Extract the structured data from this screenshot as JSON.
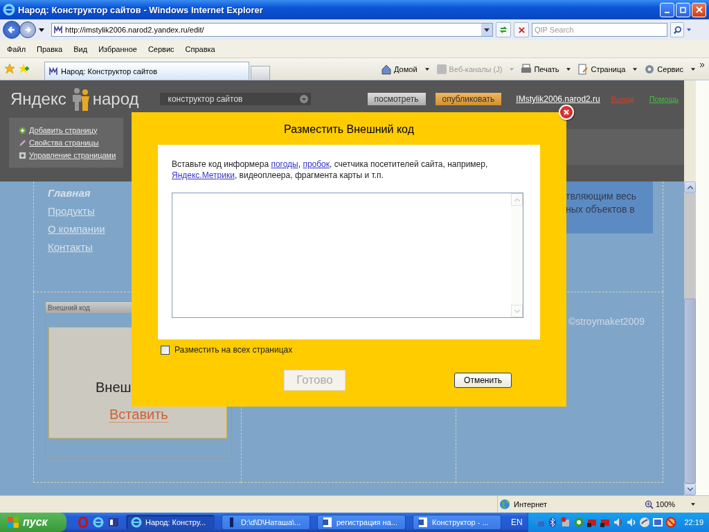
{
  "window": {
    "title": "Народ: Конструктор сайтов - Windows Internet Explorer"
  },
  "address_bar": {
    "url": "http://imstylik2006.narod2.yandex.ru/edit/"
  },
  "search": {
    "placeholder": "QIP Search"
  },
  "menu": [
    "Файл",
    "Правка",
    "Вид",
    "Избранное",
    "Сервис",
    "Справка"
  ],
  "browser_tab": {
    "title": "Народ: Конструктор сайтов"
  },
  "command_bar": [
    {
      "label": "Домой",
      "kind": "home",
      "disabled": false
    },
    {
      "label": "Веб-каналы (J)",
      "kind": "feeds",
      "disabled": true
    },
    {
      "label": "Печать",
      "kind": "print",
      "disabled": false
    },
    {
      "label": "Страница",
      "kind": "page",
      "disabled": false
    },
    {
      "label": "Сервис",
      "kind": "tools",
      "disabled": false
    }
  ],
  "site_header": {
    "logo_left": "Яндекс",
    "logo_right": "народ",
    "mode_select": "конструктор сайтов",
    "preview_button": "посмотреть",
    "publish_button": "опубликовать",
    "site_link": "IMstylik2006.narod2.ru",
    "logout": "Выход",
    "help": "Помощь",
    "actions": [
      {
        "label": "Добавить страницу",
        "kind": "add"
      },
      {
        "label": "Свойства страницы",
        "kind": "edit"
      },
      {
        "label": "Управление страницами",
        "kind": "manage"
      }
    ]
  },
  "page": {
    "nav": [
      {
        "label": "Главная",
        "selected": true
      },
      {
        "label": "Продукты",
        "selected": false
      },
      {
        "label": "О компании",
        "selected": false
      },
      {
        "label": "Контакты",
        "selected": false
      }
    ],
    "text_lines": [
      "твляющим весь",
      "ных объектов в"
    ],
    "widget": {
      "title": "Внешний код",
      "heading": "Внеш",
      "insert_link": "Вставить"
    },
    "copyright": "©stroymaket2009"
  },
  "dialog": {
    "title": "Разместить Внешний код",
    "description": [
      {
        "text": "Вставьте код информера ",
        "kind": "text"
      },
      {
        "text": "погоды",
        "kind": "link"
      },
      {
        "text": ", ",
        "kind": "text"
      },
      {
        "text": "пробок",
        "kind": "link"
      },
      {
        "text": ", счетчика посетителей сайта, например, ",
        "kind": "text"
      },
      {
        "text": "Яндекс.Метрики",
        "kind": "link"
      },
      {
        "text": ", видеоплеера, фрагмента карты и т.п.",
        "kind": "text"
      }
    ],
    "all_pages": {
      "label": "Разместить на всех страницах",
      "checked": false
    },
    "done": {
      "label": "Готово",
      "disabled": true
    },
    "cancel": {
      "label": "Отменить",
      "disabled": false
    }
  },
  "status_bar": {
    "zone": "Интернет",
    "zoom": "100%"
  },
  "taskbar": {
    "start": "пуск",
    "tasks": [
      {
        "label": "Народ: Констру...",
        "kind": "ie",
        "selected": true
      },
      {
        "label": "D:\\d\\D\\Наташа\\...",
        "kind": "folder",
        "selected": false
      },
      {
        "label": "регистрация на...",
        "kind": "word",
        "selected": false
      },
      {
        "label": "Конструктор - ...",
        "kind": "word",
        "selected": false
      }
    ],
    "language": "EN",
    "clock": "22:19"
  }
}
